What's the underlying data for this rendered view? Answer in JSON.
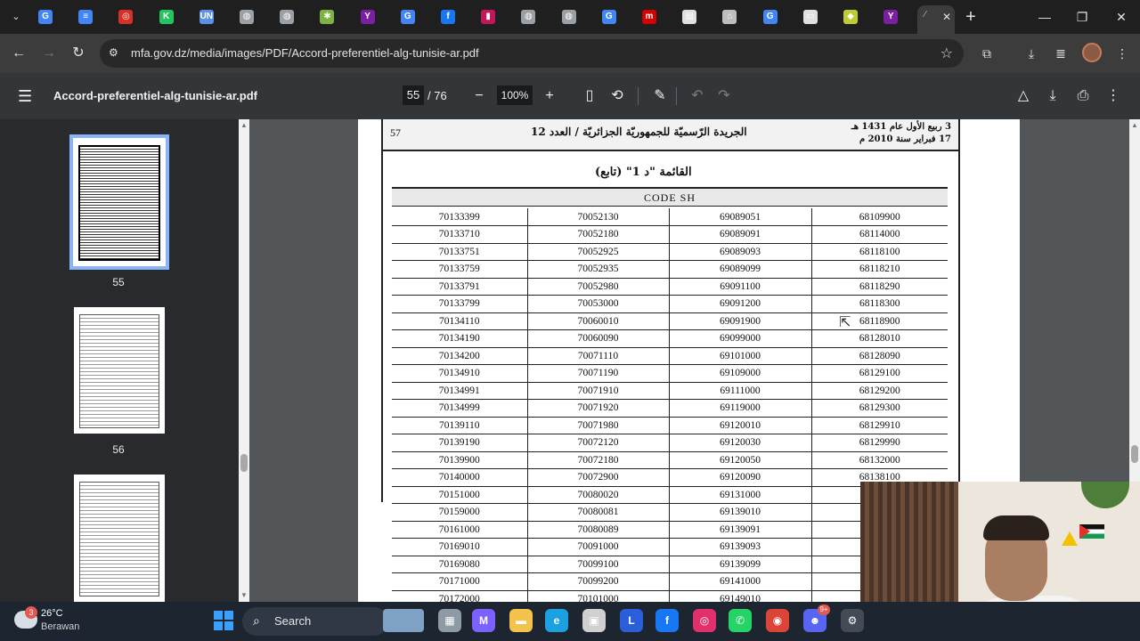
{
  "browser": {
    "tabs": [
      {
        "icon": "google-icon",
        "color": "#4285f4",
        "glyph": "G"
      },
      {
        "icon": "docs-icon",
        "color": "#4285f4",
        "glyph": "≡"
      },
      {
        "icon": "red-circle-icon",
        "color": "#d93025",
        "glyph": "◎"
      },
      {
        "icon": "k-icon",
        "color": "#22c55e",
        "glyph": "K"
      },
      {
        "icon": "un-icon",
        "color": "#5b92e5",
        "glyph": "UN"
      },
      {
        "icon": "globe-icon",
        "color": "#9aa0a6",
        "glyph": "◍"
      },
      {
        "icon": "globe-icon",
        "color": "#9aa0a6",
        "glyph": "◍"
      },
      {
        "icon": "puzzle-icon",
        "color": "#7cb342",
        "glyph": "✱"
      },
      {
        "icon": "yahoo-icon",
        "color": "#7b1fa2",
        "glyph": "Y"
      },
      {
        "icon": "google-icon",
        "color": "#4285f4",
        "glyph": "G"
      },
      {
        "icon": "facebook-icon",
        "color": "#1877f2",
        "glyph": "f"
      },
      {
        "icon": "purple-icon",
        "color": "#c2185b",
        "glyph": "▮"
      },
      {
        "icon": "globe-icon",
        "color": "#9aa0a6",
        "glyph": "◍"
      },
      {
        "icon": "globe-icon",
        "color": "#9aa0a6",
        "glyph": "◍"
      },
      {
        "icon": "google-icon",
        "color": "#4285f4",
        "glyph": "G"
      },
      {
        "icon": "m-icon",
        "color": "#d50000",
        "glyph": "m"
      },
      {
        "icon": "doc-icon",
        "color": "#e0e0e0",
        "glyph": "▤"
      },
      {
        "icon": "arch-icon",
        "color": "#bdbdbd",
        "glyph": "⌂"
      },
      {
        "icon": "google-icon",
        "color": "#4285f4",
        "glyph": "G"
      },
      {
        "icon": "screen-icon",
        "color": "#e0e0e0",
        "glyph": "▭"
      },
      {
        "icon": "yellow-icon",
        "color": "#c0ca33",
        "glyph": "◆"
      },
      {
        "icon": "yahoo-icon",
        "color": "#7b1fa2",
        "glyph": "Y"
      }
    ],
    "active_tab_glyph": "⁄",
    "new_tab": "+",
    "url": "mfa.gov.dz/media/images/PDF/Accord-preferentiel-alg-tunisie-ar.pdf"
  },
  "pdf": {
    "filename": "Accord-preferentiel-alg-tunisie-ar.pdf",
    "current_page": "55",
    "total_pages": "/ 76",
    "zoom": "100%",
    "thumbnails": [
      {
        "label": "55"
      },
      {
        "label": "56"
      },
      {
        "label": ""
      }
    ],
    "page": {
      "header_page_no": "57",
      "header_center": "الجريدة الرّسميّة للجمهوريّة الجزائريّة / العدد 12",
      "header_right_1": "3 ربيع الأول عام 1431 هـ",
      "header_right_2": "17 فبراير سنة 2010 م",
      "list_title": "القائمة \"د 1\" (تابع)",
      "code_header": "CODE SH",
      "rows": [
        [
          "70133399",
          "70052130",
          "69089051",
          "68109900"
        ],
        [
          "70133710",
          "70052180",
          "69089091",
          "68114000"
        ],
        [
          "70133751",
          "70052925",
          "69089093",
          "68118100"
        ],
        [
          "70133759",
          "70052935",
          "69089099",
          "68118210"
        ],
        [
          "70133791",
          "70052980",
          "69091100",
          "68118290"
        ],
        [
          "70133799",
          "70053000",
          "69091200",
          "68118300"
        ],
        [
          "70134110",
          "70060010",
          "69091900",
          "68118900"
        ],
        [
          "70134190",
          "70060090",
          "69099000",
          "68128010"
        ],
        [
          "70134200",
          "70071110",
          "69101000",
          "68128090"
        ],
        [
          "70134910",
          "70071190",
          "69109000",
          "68129100"
        ],
        [
          "70134991",
          "70071910",
          "69111000",
          "68129200"
        ],
        [
          "70134999",
          "70071920",
          "69119000",
          "68129300"
        ],
        [
          "70139110",
          "70071980",
          "69120010",
          "68129910"
        ],
        [
          "70139190",
          "70072120",
          "69120030",
          "68129990"
        ],
        [
          "70139900",
          "70072180",
          "69120050",
          "68132000"
        ],
        [
          "70140000",
          "70072900",
          "69120090",
          "68138100"
        ],
        [
          "70151000",
          "70080020",
          "69131000",
          "6"
        ],
        [
          "70159000",
          "70080081",
          "69139010",
          "6"
        ],
        [
          "70161000",
          "70080089",
          "69139091",
          "6"
        ],
        [
          "70169010",
          "70091000",
          "69139093",
          "6"
        ],
        [
          "70169080",
          "70099100",
          "69139099",
          "6"
        ],
        [
          "70171000",
          "70099200",
          "69141000",
          "6"
        ],
        [
          "70172000",
          "70101000",
          "69149010",
          ""
        ]
      ]
    }
  },
  "taskbar": {
    "weather_badge": "3",
    "temperature": "26°C",
    "condition": "Berawan",
    "search_label": "Search",
    "notification_badge": "9+",
    "apps": [
      {
        "icon": "files-icon",
        "color": "#8e9aa6",
        "glyph": "▦"
      },
      {
        "icon": "m365-icon",
        "color": "#7b61ff",
        "glyph": "M"
      },
      {
        "icon": "folder-icon",
        "color": "#f5c24c",
        "glyph": "▬"
      },
      {
        "icon": "edge-icon",
        "color": "#1ba1e2",
        "glyph": "e"
      },
      {
        "icon": "store-icon",
        "color": "#d0d0d0",
        "glyph": "▣"
      },
      {
        "icon": "l-icon",
        "color": "#2b5fd9",
        "glyph": "L"
      },
      {
        "icon": "facebook-icon",
        "color": "#1877f2",
        "glyph": "f"
      },
      {
        "icon": "instagram-icon",
        "color": "#e1306c",
        "glyph": "◎"
      },
      {
        "icon": "whatsapp-icon",
        "color": "#25d366",
        "glyph": "✆"
      },
      {
        "icon": "chrome-icon",
        "color": "#db4437",
        "glyph": "◉"
      },
      {
        "icon": "discord-icon",
        "color": "#5865f2",
        "glyph": "☻"
      },
      {
        "icon": "app-icon",
        "color": "#444b55",
        "glyph": "⚙"
      }
    ]
  }
}
